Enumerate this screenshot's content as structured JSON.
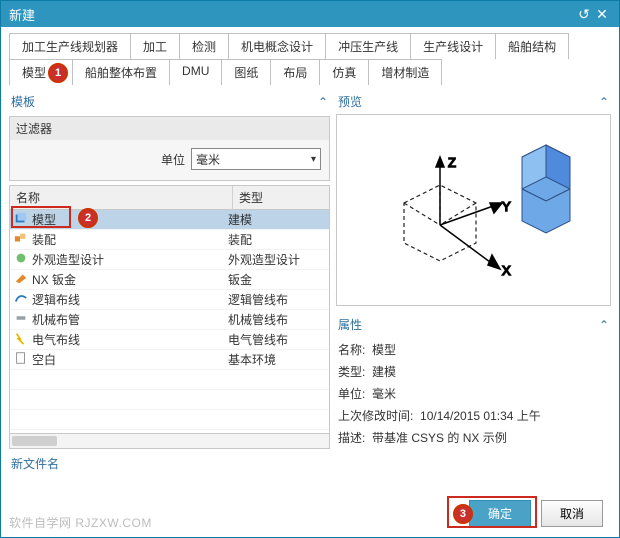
{
  "window": {
    "title": "新建",
    "reset_tip": "↺",
    "close_tip": "✕"
  },
  "tabs_row1": [
    "加工生产线规划器",
    "加工",
    "检测",
    "机电概念设计",
    "冲压生产线",
    "生产线设计",
    "船舶结构"
  ],
  "tabs_row2": [
    "模型",
    "船舶整体布置",
    "DMU",
    "图纸",
    "布局",
    "仿真",
    "增材制造"
  ],
  "active_tab": "模型",
  "template": {
    "heading": "模板",
    "filter_title": "过滤器",
    "unit_label": "单位",
    "unit_value": "毫米",
    "col_name": "名称",
    "col_type": "类型",
    "rows": [
      {
        "icon": "model",
        "name": "模型",
        "type": "建模",
        "selected": true
      },
      {
        "icon": "assembly",
        "name": "装配",
        "type": "装配"
      },
      {
        "icon": "shape",
        "name": "外观造型设计",
        "type": "外观造型设计"
      },
      {
        "icon": "sheetmetal",
        "name": "NX 钣金",
        "type": "钣金"
      },
      {
        "icon": "routing",
        "name": "逻辑布线",
        "type": "逻辑管线布"
      },
      {
        "icon": "mech",
        "name": "机械布管",
        "type": "机械管线布"
      },
      {
        "icon": "elec",
        "name": "电气布线",
        "type": "电气管线布"
      },
      {
        "icon": "blank",
        "name": "空白",
        "type": "基本环境"
      }
    ]
  },
  "preview": {
    "heading": "预览"
  },
  "properties": {
    "heading": "属性",
    "name_label": "名称:",
    "name_value": "模型",
    "type_label": "类型:",
    "type_value": "建模",
    "unit_label": "单位:",
    "unit_value": "毫米",
    "modified_label": "上次修改时间:",
    "modified_value": "10/14/2015 01:34 上午",
    "desc_label": "描述:",
    "desc_value": "带基准 CSYS 的 NX 示例"
  },
  "newfile_heading": "新文件名",
  "buttons": {
    "ok": "确定",
    "cancel": "取消"
  },
  "callouts": {
    "a": "1",
    "b": "2",
    "c": "3"
  },
  "watermark": "软件自学网 RJZXW.COM"
}
